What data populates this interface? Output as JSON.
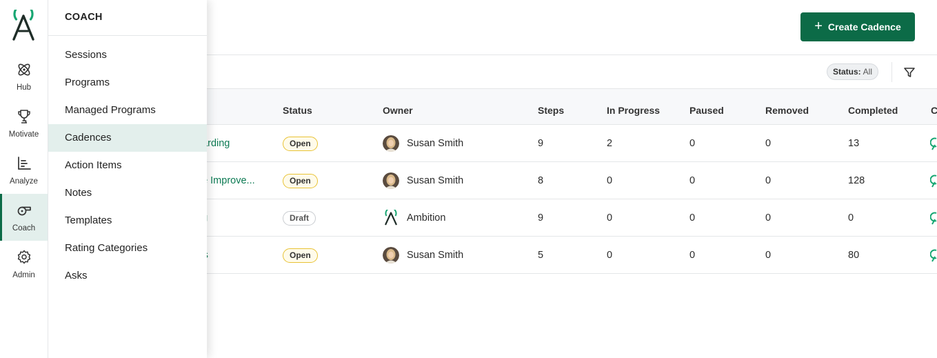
{
  "rail": {
    "items": [
      {
        "label": "Hub",
        "icon": "atom-icon",
        "active": false
      },
      {
        "label": "Motivate",
        "icon": "trophy-icon",
        "active": false
      },
      {
        "label": "Analyze",
        "icon": "bar-chart-icon",
        "active": false
      },
      {
        "label": "Coach",
        "icon": "whistle-icon",
        "active": true
      },
      {
        "label": "Admin",
        "icon": "gear-icon",
        "active": false
      }
    ]
  },
  "flyout": {
    "title": "COACH",
    "items": [
      {
        "label": "Sessions"
      },
      {
        "label": "Programs"
      },
      {
        "label": "Managed Programs"
      },
      {
        "label": "Cadences",
        "active": true
      },
      {
        "label": "Action Items"
      },
      {
        "label": "Notes"
      },
      {
        "label": "Templates"
      },
      {
        "label": "Rating Categories"
      },
      {
        "label": "Asks"
      }
    ]
  },
  "header": {
    "create_label": "Create Cadence"
  },
  "toolbar": {
    "status_key": "Status:",
    "status_value": "All"
  },
  "table": {
    "columns": [
      "Status",
      "Owner",
      "Steps",
      "In Progress",
      "Paused",
      "Removed",
      "Completed",
      "C"
    ],
    "rows": [
      {
        "name": "oarding",
        "status": "Open",
        "owner": "Susan Smith",
        "owner_type": "user",
        "steps": "9",
        "in_progress": "2",
        "paused": "0",
        "removed": "0",
        "completed": "13"
      },
      {
        "name": "ne Improve...",
        "status": "Open",
        "owner": "Susan Smith",
        "owner_type": "user",
        "steps": "8",
        "in_progress": "0",
        "paused": "0",
        "removed": "0",
        "completed": "128"
      },
      {
        "name": "ng",
        "status": "Draft",
        "owner": "Ambition",
        "owner_type": "org",
        "steps": "9",
        "in_progress": "0",
        "paused": "0",
        "removed": "0",
        "completed": "0"
      },
      {
        "name": "Es",
        "status": "Open",
        "owner": "Susan Smith",
        "owner_type": "user",
        "steps": "5",
        "in_progress": "0",
        "paused": "0",
        "removed": "0",
        "completed": "80"
      }
    ]
  },
  "colors": {
    "brand": "#0c6b47",
    "link": "#0c7a53",
    "open_badge_border": "#e8c234",
    "active_bg": "#e3efec"
  }
}
